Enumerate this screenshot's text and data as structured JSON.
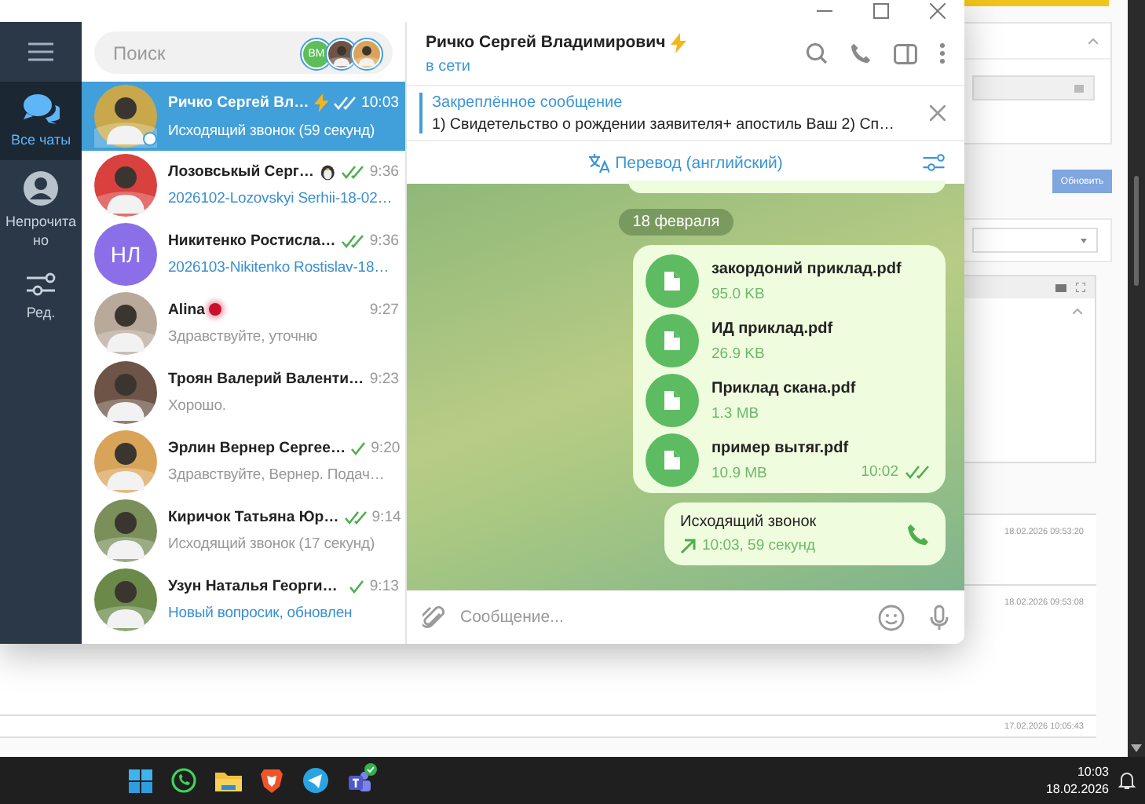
{
  "background_page": {
    "button": "Обновить",
    "timestamps": [
      "18.02.2026 09:53:20",
      "18.02.2026 09:53:08",
      "17.02.2026 10:05:43"
    ]
  },
  "sidebar": {
    "items": [
      {
        "kind": "menu"
      },
      {
        "kind": "all",
        "label": "Все чаты",
        "selected": true
      },
      {
        "kind": "unread",
        "label": "Непрочитано",
        "selected": false
      },
      {
        "kind": "edit",
        "label": "Ред."
      }
    ]
  },
  "search": {
    "placeholder": "Поиск",
    "stories": [
      {
        "kind": "initials",
        "text": "ВМ"
      },
      {
        "kind": "photo"
      },
      {
        "kind": "photo"
      }
    ]
  },
  "chats": [
    {
      "name": "Ричко Сергей Вл…",
      "premium": true,
      "emoji_status": false,
      "live": false,
      "sent": true,
      "read": true,
      "time": "10:03",
      "preview": "Исходящий звонок (59 секунд)",
      "attachment": false,
      "online": true,
      "selected": true,
      "avatar": {
        "kind": "photo"
      }
    },
    {
      "name": "Лозовськый Серг…",
      "premium": false,
      "emoji_status": true,
      "live": false,
      "sent": true,
      "read": true,
      "time": "9:36",
      "preview": "2026102-Lozovskyi Serhii-18-02…",
      "attachment": true,
      "online": false,
      "selected": false,
      "avatar": {
        "kind": "photo"
      }
    },
    {
      "name": "Никитенко Ростисла…",
      "premium": false,
      "emoji_status": false,
      "live": false,
      "sent": true,
      "read": true,
      "time": "9:36",
      "preview": "2026103-Nikitenko Rostislav-18…",
      "attachment": true,
      "online": false,
      "selected": false,
      "avatar": {
        "kind": "initials",
        "text": "НЛ",
        "color": "#8b6fe8"
      }
    },
    {
      "name": "Alina",
      "premium": false,
      "emoji_status": false,
      "live": true,
      "sent": false,
      "read": false,
      "time": "9:27",
      "preview": "Здравствуйте, уточню",
      "attachment": false,
      "online": false,
      "selected": false,
      "avatar": {
        "kind": "photo"
      }
    },
    {
      "name": "Троян Валерий Валенти…",
      "premium": false,
      "emoji_status": false,
      "live": false,
      "sent": false,
      "read": false,
      "time": "9:23",
      "preview": "Хорошо.",
      "attachment": false,
      "online": false,
      "selected": false,
      "avatar": {
        "kind": "photo"
      }
    },
    {
      "name": "Эрлин Вернер Сергее…",
      "premium": false,
      "emoji_status": false,
      "live": false,
      "sent": true,
      "read": false,
      "time": "9:20",
      "preview": "Здравствуйте, Вернер. Подач…",
      "attachment": false,
      "online": false,
      "selected": false,
      "avatar": {
        "kind": "photo"
      }
    },
    {
      "name": "Киричок Татьяна Юр…",
      "premium": false,
      "emoji_status": false,
      "live": false,
      "sent": true,
      "read": true,
      "time": "9:14",
      "preview": "Исходящий звонок (17 секунд)",
      "attachment": false,
      "online": false,
      "selected": false,
      "avatar": {
        "kind": "photo"
      }
    },
    {
      "name": "Узун Наталья Георги…",
      "premium": false,
      "emoji_status": false,
      "live": false,
      "sent": true,
      "read": false,
      "time": "9:13",
      "preview": "Новый вопросик, обновлен",
      "attachment": true,
      "online": false,
      "selected": false,
      "avatar": {
        "kind": "photo"
      }
    }
  ],
  "chat_header": {
    "name": "Ричко Сергей Владимирович",
    "premium": true,
    "status": "в сети"
  },
  "pinned": {
    "title": "Закреплённое сообщение",
    "text": "1) Свидетельство о рождении заявителя+ апостиль Ваш 2) Сп…"
  },
  "translate": {
    "label": "Перевод (английский)"
  },
  "date_separator": "18 февраля",
  "messages": [
    {
      "kind": "files",
      "files": [
        {
          "name": "закордоний приклад.pdf",
          "size": "95.0 KB"
        },
        {
          "name": "ИД приклад.pdf",
          "size": "26.9 KB"
        },
        {
          "name": "Приклад скана.pdf",
          "size": "1.3 MB"
        },
        {
          "name": "пример вытяг.pdf",
          "size": "10.9 MB"
        }
      ],
      "time": "10:02",
      "sent": true,
      "read": true
    },
    {
      "kind": "call",
      "title": "Исходящий звонок",
      "detail": "10:03, 59 секунд"
    }
  ],
  "composer": {
    "placeholder": "Сообщение..."
  },
  "taskbar": {
    "apps": [
      {
        "kind": "start"
      },
      {
        "kind": "whatsapp"
      },
      {
        "kind": "files"
      },
      {
        "kind": "browser"
      },
      {
        "kind": "telegram"
      },
      {
        "kind": "teams",
        "badge": true
      }
    ],
    "time": "10:03",
    "date": "18.02.2026"
  }
}
